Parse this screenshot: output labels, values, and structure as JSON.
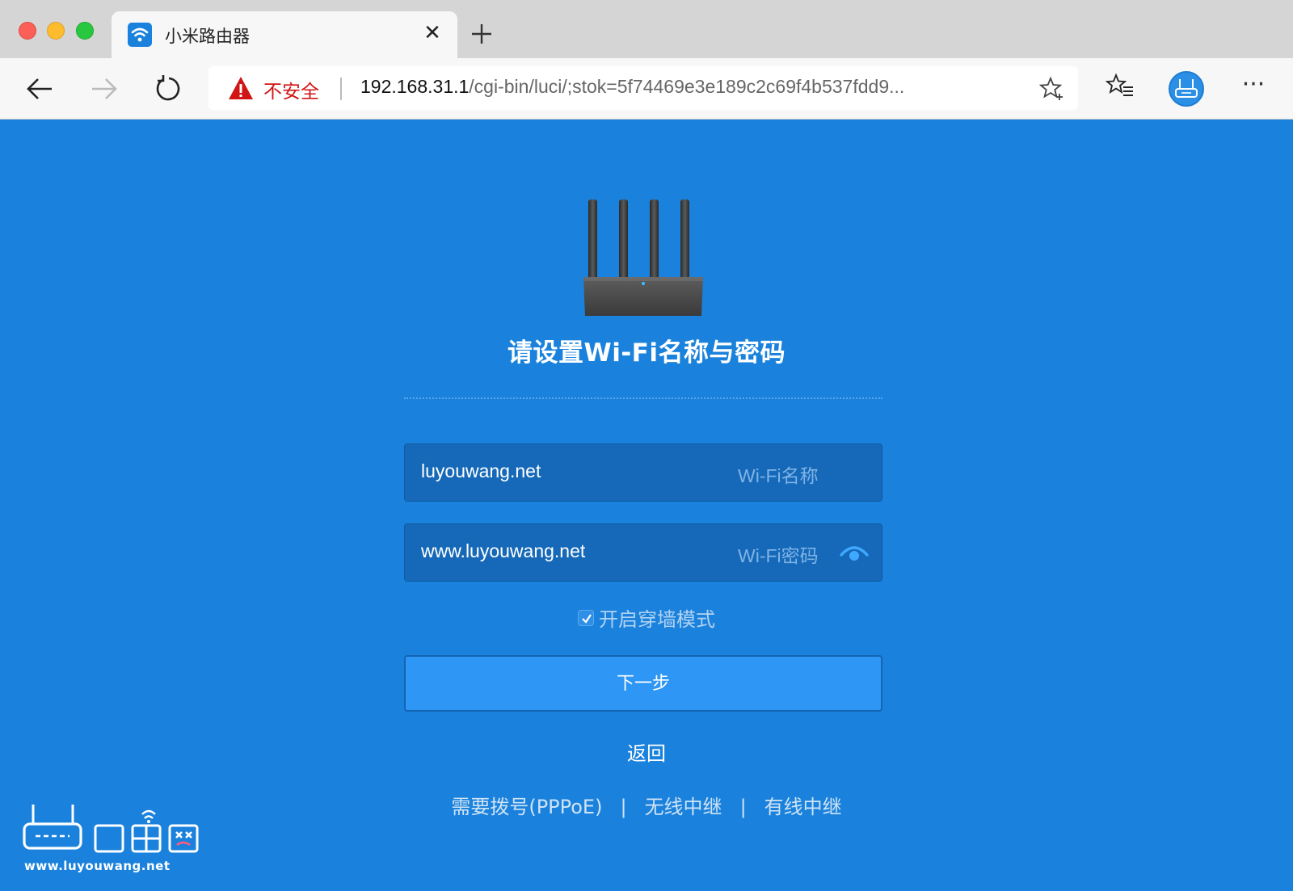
{
  "browser": {
    "tab_title": "小米路由器",
    "tab_close_glyph": "✕",
    "security_label": "不安全",
    "url_host": "192.168.31.1",
    "url_path": "/cgi-bin/luci/;stok=5f74469e3e189c2c69f4b537fdd9...",
    "more_glyph": "···"
  },
  "page": {
    "title": "请设置Wi-Fi名称与密码",
    "ssid_value": "luyouwang.net",
    "ssid_label": "Wi-Fi名称",
    "password_value": "www.luyouwang.net",
    "password_label": "Wi-Fi密码",
    "wall_mode_label": "开启穿墙模式",
    "wall_mode_checked": true,
    "next_button": "下一步",
    "back_link": "返回",
    "links": [
      "需要拨号(PPPoE)",
      "无线中继",
      "有线中继"
    ],
    "link_separator": "|"
  },
  "watermark": {
    "text": "www.luyouwang.net"
  },
  "colors": {
    "background": "#1a82dc",
    "field_bg": "#1569b8",
    "button_bg": "#2e96f5",
    "insecure_red": "#d11414"
  },
  "icons": [
    "wifi-favicon-icon",
    "back-arrow-icon",
    "forward-arrow-icon",
    "refresh-icon",
    "warning-icon",
    "star-add-icon",
    "favorites-icon",
    "router-profile-icon",
    "more-icon",
    "eye-icon",
    "checkbox-check-icon"
  ]
}
